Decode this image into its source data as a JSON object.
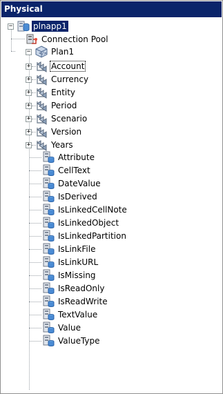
{
  "panel": {
    "title": "Physical"
  },
  "tree": {
    "root": {
      "label": "plnapp1",
      "toggle": "−",
      "icon": "database-icon",
      "selected": true
    },
    "connection_pool": {
      "label": "Connection Pool",
      "icon": "connection-pool-icon"
    },
    "plan": {
      "label": "Plan1",
      "toggle": "−",
      "icon": "cube-icon"
    },
    "dimensions": [
      {
        "label": "Account",
        "toggle": "+",
        "icon": "hierarchy-icon",
        "focused": true
      },
      {
        "label": "Currency",
        "toggle": "+",
        "icon": "hierarchy-icon"
      },
      {
        "label": "Entity",
        "toggle": "+",
        "icon": "hierarchy-icon"
      },
      {
        "label": "Period",
        "toggle": "+",
        "icon": "hierarchy-icon"
      },
      {
        "label": "Scenario",
        "toggle": "+",
        "icon": "hierarchy-icon"
      },
      {
        "label": "Version",
        "toggle": "+",
        "icon": "hierarchy-icon"
      },
      {
        "label": "Years",
        "toggle": "+",
        "icon": "hierarchy-icon"
      }
    ],
    "columns": [
      {
        "label": "Attribute",
        "icon": "column-icon"
      },
      {
        "label": "CellText",
        "icon": "column-icon"
      },
      {
        "label": "DateValue",
        "icon": "column-icon"
      },
      {
        "label": "IsDerived",
        "icon": "column-icon"
      },
      {
        "label": "IsLinkedCellNote",
        "icon": "column-icon"
      },
      {
        "label": "IsLinkedObject",
        "icon": "column-icon"
      },
      {
        "label": "IsLinkedPartition",
        "icon": "column-icon"
      },
      {
        "label": "IsLinkFile",
        "icon": "column-icon"
      },
      {
        "label": "IsLinkURL",
        "icon": "column-icon"
      },
      {
        "label": "IsMissing",
        "icon": "column-icon"
      },
      {
        "label": "IsReadOnly",
        "icon": "column-icon"
      },
      {
        "label": "IsReadWrite",
        "icon": "column-icon"
      },
      {
        "label": "TextValue",
        "icon": "column-icon"
      },
      {
        "label": "Value",
        "icon": "column-icon"
      },
      {
        "label": "ValueType",
        "icon": "column-icon"
      }
    ]
  },
  "colors": {
    "selection": "#0a246a",
    "tree_line": "#9aa0a6",
    "border": "#8f8f8f"
  }
}
